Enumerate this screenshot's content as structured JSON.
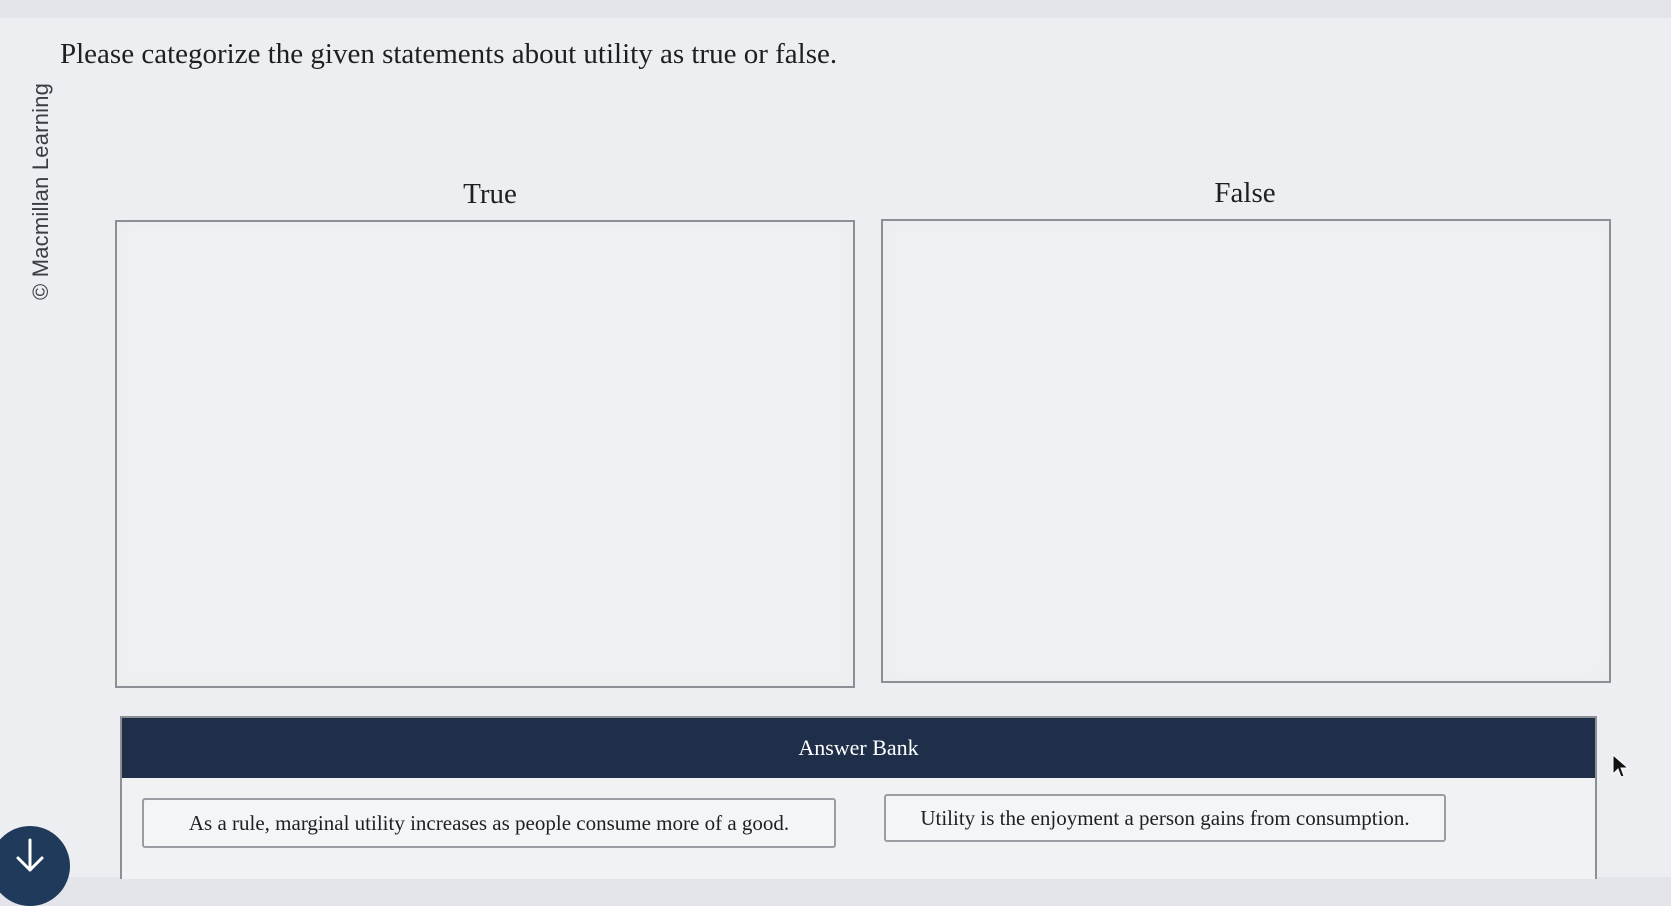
{
  "question": "Please categorize the given statements about utility as true or false.",
  "copyright": "© Macmillan Learning",
  "bins": {
    "true_label": "True",
    "false_label": "False"
  },
  "answer_bank": {
    "title": "Answer Bank",
    "items": [
      "As a rule, marginal utility increases as people consume more of a good.",
      "Utility is the enjoyment a person gains from consumption."
    ]
  },
  "icons": {
    "download": "arrow-down-icon",
    "cursor": "mouse-pointer-icon"
  },
  "colors": {
    "bank_header": "#1f2f49",
    "bank_header_text": "#ffffff",
    "download_button": "#1f3a5a"
  }
}
